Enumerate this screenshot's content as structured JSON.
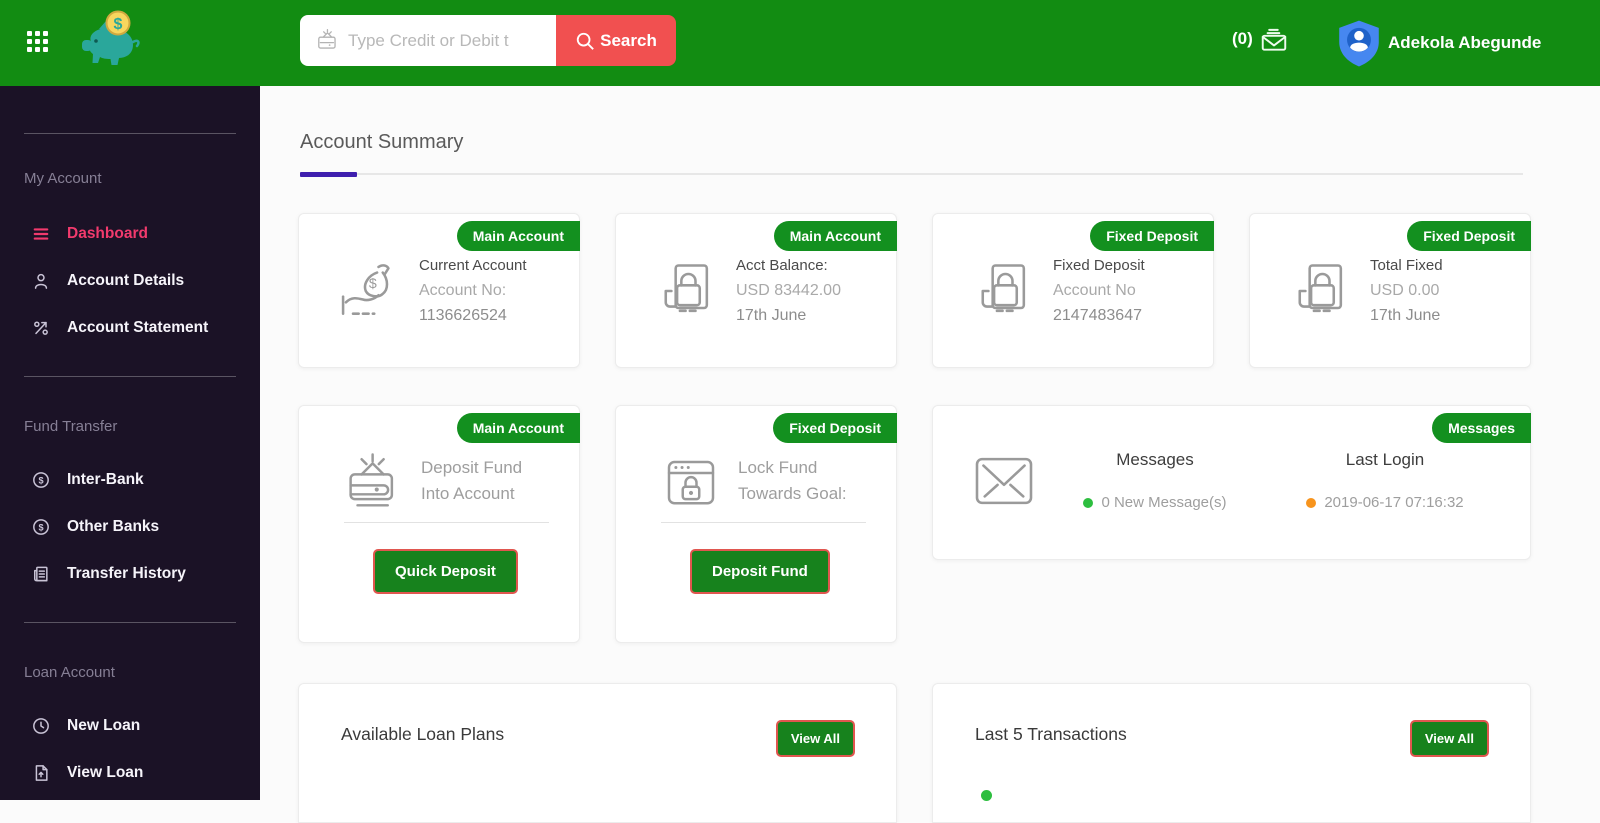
{
  "colors": {
    "header_green": "#128c12",
    "badge_green": "#13901f",
    "button_green": "#17821d",
    "button_border_red": "#e0564f",
    "search_red": "#f15050",
    "sidebar_bg": "#1b1226",
    "active_pink": "#f23a6d",
    "accent_purple": "#3f1fae",
    "dot_green": "#2dbe3f",
    "dot_orange": "#f7941d"
  },
  "header": {
    "search_placeholder": "Type Credit or Debit t",
    "search_button_label": "Search",
    "mail_count": "(0)",
    "user_name": "Adekola Abegunde"
  },
  "sidebar": {
    "sections": [
      {
        "label": "My Account",
        "items": [
          {
            "label": "Dashboard",
            "icon": "menu-icon",
            "active": true
          },
          {
            "label": "Account Details",
            "icon": "user-icon",
            "active": false
          },
          {
            "label": "Account Statement",
            "icon": "percent-arrow-icon",
            "active": false
          }
        ]
      },
      {
        "label": "Fund Transfer",
        "items": [
          {
            "label": "Inter-Bank",
            "icon": "dollar-circle-icon",
            "active": false
          },
          {
            "label": "Other Banks",
            "icon": "dollar-circle-icon",
            "active": false
          },
          {
            "label": "Transfer History",
            "icon": "document-icon",
            "active": false
          }
        ]
      },
      {
        "label": "Loan Account",
        "items": [
          {
            "label": "New Loan",
            "icon": "clock-icon",
            "active": false
          },
          {
            "label": "View Loan",
            "icon": "file-arrow-icon",
            "active": false
          }
        ]
      }
    ]
  },
  "main": {
    "title": "Account Summary",
    "summary_cards": [
      {
        "badge": "Main Account",
        "icon": "money-bag-hand-icon",
        "line1": "Current Account",
        "line2": "Account No:",
        "line3": "1136626524"
      },
      {
        "badge": "Main Account",
        "icon": "bag-document-icon",
        "line1": "Acct Balance:",
        "line2": "USD 83442.00",
        "line3": "17th June"
      },
      {
        "badge": "Fixed Deposit",
        "icon": "bag-document-icon",
        "line1": "Fixed Deposit",
        "line2": "Account No",
        "line3": "2147483647"
      },
      {
        "badge": "Fixed Deposit",
        "icon": "bag-document-icon",
        "line1": "Total Fixed",
        "line2": "USD 0.00",
        "line3": "17th June"
      }
    ],
    "action_cards": [
      {
        "badge": "Main Account",
        "icon": "wallet-deposit-icon",
        "line1": "Deposit Fund",
        "line2": "Into Account",
        "button": "Quick Deposit"
      },
      {
        "badge": "Fixed Deposit",
        "icon": "lock-window-icon",
        "line1": "Lock Fund",
        "line2": "Towards Goal:",
        "button": "Deposit Fund"
      }
    ],
    "messages_card": {
      "badge": "Messages",
      "icon": "envelope-icon",
      "columns": [
        {
          "title": "Messages",
          "value": "0 New Message(s)"
        },
        {
          "title": "Last Login",
          "value": "2019-06-17 07:16:32"
        }
      ]
    },
    "bottom_cards": [
      {
        "title": "Available Loan Plans",
        "button": "View All"
      },
      {
        "title": "Last 5 Transactions",
        "button": "View All"
      }
    ]
  }
}
